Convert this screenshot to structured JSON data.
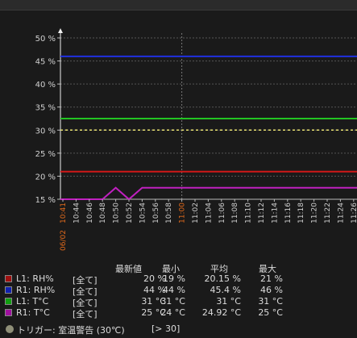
{
  "chart_data": {
    "type": "line",
    "date_label": "06/02",
    "x": [
      "10:41",
      "10:44",
      "10:46",
      "10:48",
      "10:50",
      "10:52",
      "10:54",
      "10:56",
      "10:58",
      "11:00",
      "11:02",
      "11:04",
      "11:06",
      "11:08",
      "11:10",
      "11:12",
      "11:14",
      "11:16",
      "11:18",
      "11:20",
      "11:22",
      "11:24",
      "11:26"
    ],
    "highlight_labels": [
      "10:41",
      "11:00"
    ],
    "y_ticks": [
      "50 %",
      "45 %",
      "40 %",
      "35 %",
      "30 %",
      "25 %",
      "20 %",
      "15 %"
    ],
    "ylim": [
      15,
      50
    ],
    "grid": true,
    "series": [
      {
        "name": "L1: RH%",
        "color": "#d01818",
        "values": [
          21,
          21,
          21,
          21,
          21,
          21,
          21,
          21,
          21,
          21,
          21,
          21,
          21,
          21,
          21,
          21,
          21,
          21,
          21,
          21,
          21,
          21,
          21
        ]
      },
      {
        "name": "R1: RH%",
        "color": "#2030e0",
        "values": [
          46,
          46,
          46,
          46,
          46,
          46,
          46,
          46,
          46,
          46,
          46,
          46,
          46,
          46,
          46,
          46,
          46,
          46,
          46,
          46,
          46,
          46,
          46
        ]
      },
      {
        "name": "L1: T°C",
        "color": "#22c422",
        "values": [
          32.5,
          32.5,
          32.5,
          32.5,
          32.5,
          32.5,
          32.5,
          32.5,
          32.5,
          32.5,
          32.5,
          32.5,
          32.5,
          32.5,
          32.5,
          32.5,
          32.5,
          32.5,
          32.5,
          32.5,
          32.5,
          32.5,
          32.5
        ]
      },
      {
        "name": "R1: T°C",
        "color": "#c020c0",
        "values": [
          15,
          15,
          15,
          15,
          17.5,
          15,
          17.5,
          17.5,
          17.5,
          17.5,
          17.5,
          17.5,
          17.5,
          17.5,
          17.5,
          17.5,
          17.5,
          17.5,
          17.5,
          17.5,
          17.5,
          17.5,
          17.5
        ]
      }
    ],
    "threshold": {
      "label": "トリガー: 室温警告 (30℃)",
      "value": 30,
      "color": "#e8e070"
    }
  },
  "legend": {
    "headers": {
      "latest": "最新値",
      "min": "最小",
      "avg": "平均",
      "max": "最大"
    },
    "rows": [
      {
        "name": "L1: RH%",
        "scope": "[全て]",
        "latest": "20 %",
        "min": "19 %",
        "avg": "20.15 %",
        "max": "21 %",
        "color": "#a01010"
      },
      {
        "name": "R1: RH%",
        "scope": "[全て]",
        "latest": "44 %",
        "min": "44 %",
        "avg": "45.4 %",
        "max": "46 %",
        "color": "#1020b0"
      },
      {
        "name": "L1: T°C",
        "scope": "[全て]",
        "latest": "31 °C",
        "min": "31 °C",
        "avg": "31 °C",
        "max": "31 °C",
        "color": "#10a010"
      },
      {
        "name": "R1: T°C",
        "scope": "[全て]",
        "latest": "25 °C",
        "min": "24 °C",
        "avg": "24.92 °C",
        "max": "25 °C",
        "color": "#a010a0"
      }
    ]
  },
  "trigger": {
    "label": "トリガー: 室温警告 (30℃)",
    "condition": "[> 30]",
    "color": "#8f8f78"
  }
}
